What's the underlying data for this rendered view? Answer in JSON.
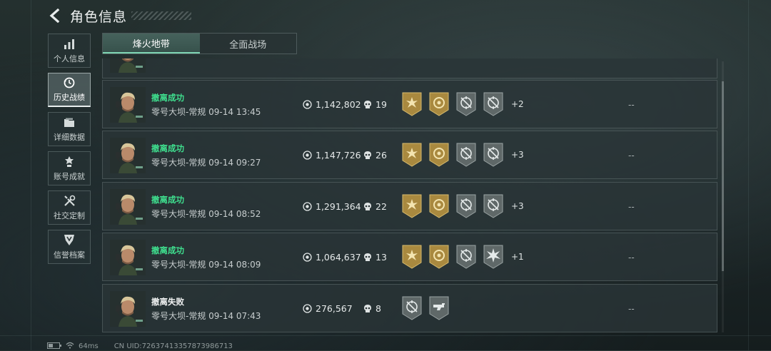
{
  "header": {
    "title": "角色信息"
  },
  "sidebar": {
    "items": [
      {
        "label": "个人信息",
        "icon": "bar-chart-icon"
      },
      {
        "label": "历史战绩",
        "icon": "history-icon",
        "active": true
      },
      {
        "label": "详细数据",
        "icon": "folder-icon"
      },
      {
        "label": "账号成就",
        "icon": "achievement-icon"
      },
      {
        "label": "社交定制",
        "icon": "tools-icon"
      },
      {
        "label": "信誉档案",
        "icon": "shield-icon"
      }
    ]
  },
  "tabs": [
    {
      "label": "烽火地带",
      "active": true
    },
    {
      "label": "全面战场",
      "active": false
    }
  ],
  "records": [
    {
      "result": "撤离成功",
      "status": "success",
      "map": "零号大坝-常规 09-14 13:45",
      "value": "1,142,802",
      "kills": "19",
      "extra": "+2",
      "dash": "--"
    },
    {
      "result": "撤离成功",
      "status": "success",
      "map": "零号大坝-常规 09-14 09:27",
      "value": "1,147,726",
      "kills": "26",
      "extra": "+3",
      "dash": "--"
    },
    {
      "result": "撤离成功",
      "status": "success",
      "map": "零号大坝-常规 09-14 08:52",
      "value": "1,291,364",
      "kills": "22",
      "extra": "+3",
      "dash": "--"
    },
    {
      "result": "撤离成功",
      "status": "success",
      "map": "零号大坝-常规 09-14 08:09",
      "value": "1,064,637",
      "kills": "13",
      "extra": "+1",
      "dash": "--"
    },
    {
      "result": "撤离失败",
      "status": "fail",
      "map": "零号大坝-常规 09-14 07:43",
      "value": "276,567",
      "kills": "8",
      "extra": "",
      "dash": "--"
    }
  ],
  "footer": {
    "ping": "64ms",
    "uid": "CN UID:7263741335787398671​3"
  },
  "colors": {
    "success": "#3fe08f",
    "accent": "#7fd6b4",
    "gold_badge": "#b8994a",
    "grey_badge": "#6e7676"
  }
}
